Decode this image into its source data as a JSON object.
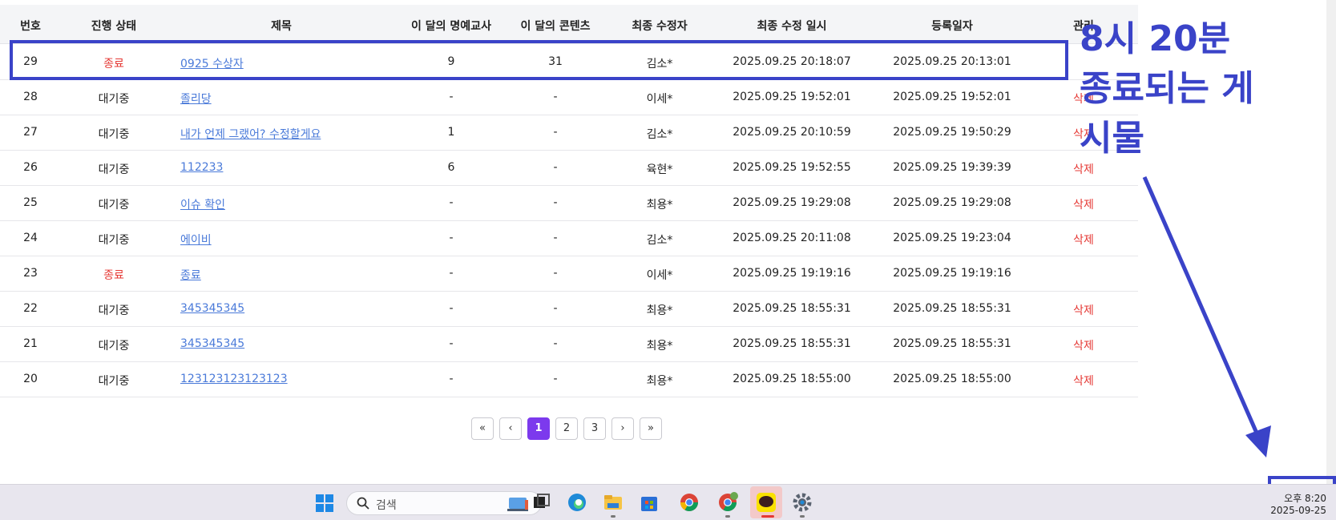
{
  "table": {
    "headers": [
      "번호",
      "진행 상태",
      "제목",
      "이 달의 명예교사",
      "이 달의 콘텐츠",
      "최종 수정자",
      "최종 수정 일시",
      "등록일자",
      "관리"
    ],
    "rows": [
      {
        "no": "29",
        "status": "종료",
        "title": "0925 수상자",
        "honor": "9",
        "contents": "31",
        "editor": "김소*",
        "modified": "2025.09.25 20:18:07",
        "registered": "2025.09.25 20:13:01",
        "action": ""
      },
      {
        "no": "28",
        "status": "대기중",
        "title": "졸리당",
        "honor": "-",
        "contents": "-",
        "editor": "이세*",
        "modified": "2025.09.25 19:52:01",
        "registered": "2025.09.25 19:52:01",
        "action": "삭제"
      },
      {
        "no": "27",
        "status": "대기중",
        "title": "내가 언제 그랬어? 수정할게요",
        "honor": "1",
        "contents": "-",
        "editor": "김소*",
        "modified": "2025.09.25 20:10:59",
        "registered": "2025.09.25 19:50:29",
        "action": "삭제"
      },
      {
        "no": "26",
        "status": "대기중",
        "title": "112233",
        "honor": "6",
        "contents": "-",
        "editor": "육현*",
        "modified": "2025.09.25 19:52:55",
        "registered": "2025.09.25 19:39:39",
        "action": "삭제"
      },
      {
        "no": "25",
        "status": "대기중",
        "title": "이슈 확인",
        "honor": "-",
        "contents": "-",
        "editor": "최용*",
        "modified": "2025.09.25 19:29:08",
        "registered": "2025.09.25 19:29:08",
        "action": "삭제"
      },
      {
        "no": "24",
        "status": "대기중",
        "title": "에이비",
        "honor": "-",
        "contents": "-",
        "editor": "김소*",
        "modified": "2025.09.25 20:11:08",
        "registered": "2025.09.25 19:23:04",
        "action": "삭제"
      },
      {
        "no": "23",
        "status": "종료",
        "title": "종료",
        "honor": "-",
        "contents": "-",
        "editor": "이세*",
        "modified": "2025.09.25 19:19:16",
        "registered": "2025.09.25 19:19:16",
        "action": ""
      },
      {
        "no": "22",
        "status": "대기중",
        "title": "345345345",
        "honor": "-",
        "contents": "-",
        "editor": "최용*",
        "modified": "2025.09.25 18:55:31",
        "registered": "2025.09.25 18:55:31",
        "action": "삭제"
      },
      {
        "no": "21",
        "status": "대기중",
        "title": "345345345",
        "honor": "-",
        "contents": "-",
        "editor": "최용*",
        "modified": "2025.09.25 18:55:31",
        "registered": "2025.09.25 18:55:31",
        "action": "삭제"
      },
      {
        "no": "20",
        "status": "대기중",
        "title": "123123123123123",
        "honor": "-",
        "contents": "-",
        "editor": "최용*",
        "modified": "2025.09.25 18:55:00",
        "registered": "2025.09.25 18:55:00",
        "action": "삭제"
      }
    ]
  },
  "pagination": {
    "first": "«",
    "prev": "‹",
    "pages": [
      "1",
      "2",
      "3"
    ],
    "current": "1",
    "next": "›",
    "last": "»"
  },
  "annotation": {
    "text": "8시 20분\n종료되는 게\n시물",
    "color": "#3a43c8"
  },
  "taskbar": {
    "search_placeholder": "검색",
    "clock_time": "오후 8:20",
    "clock_date": "2025-09-25",
    "icons": [
      "windows-start-icon",
      "search-icon",
      "task-view-icon",
      "edge-icon",
      "file-explorer-icon",
      "store-icon",
      "chrome-icon",
      "chrome-profile-icon",
      "kakaotalk-icon",
      "settings-icon"
    ]
  },
  "colors": {
    "accent": "#7c3aed",
    "status_done": "#e53935",
    "link": "#4a7ad9"
  }
}
